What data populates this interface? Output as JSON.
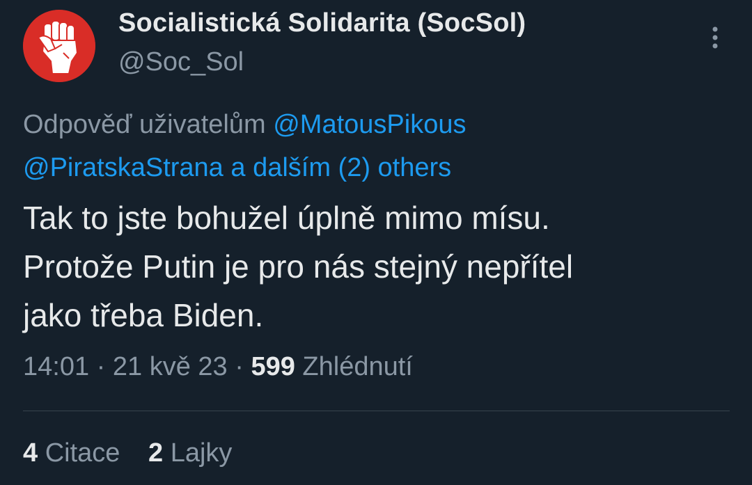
{
  "author": {
    "display_name": "Socialistická Solidarita (SocSol)",
    "handle": "@Soc_Sol",
    "avatar_icon": "raised-fist-icon",
    "avatar_color": "#d92d27"
  },
  "more_icon": "more-vertical-icon",
  "reply_to": {
    "prefix": "Odpověď uživatelům",
    "mentions": [
      "@MatousPikous",
      "@PiratskaStrana"
    ],
    "suffix": "a dalším (2) others"
  },
  "tweet_text": [
    "Tak to jste bohužel úplně mimo mísu.",
    "Protože Putin je pro nás stejný nepřítel",
    "jako třeba Biden."
  ],
  "meta": {
    "time": "14:01",
    "separator": "·",
    "date": "21 kvě 23",
    "views_count": "599",
    "views_label": "Zhlédnutí"
  },
  "stats": {
    "quotes_count": "4",
    "quotes_label": "Citace",
    "likes_count": "2",
    "likes_label": "Lajky"
  },
  "colors": {
    "background": "#15202b",
    "text_primary": "#e7e9ea",
    "text_secondary": "#8b98a5",
    "link": "#1d9bf0",
    "divider": "#38444d"
  }
}
